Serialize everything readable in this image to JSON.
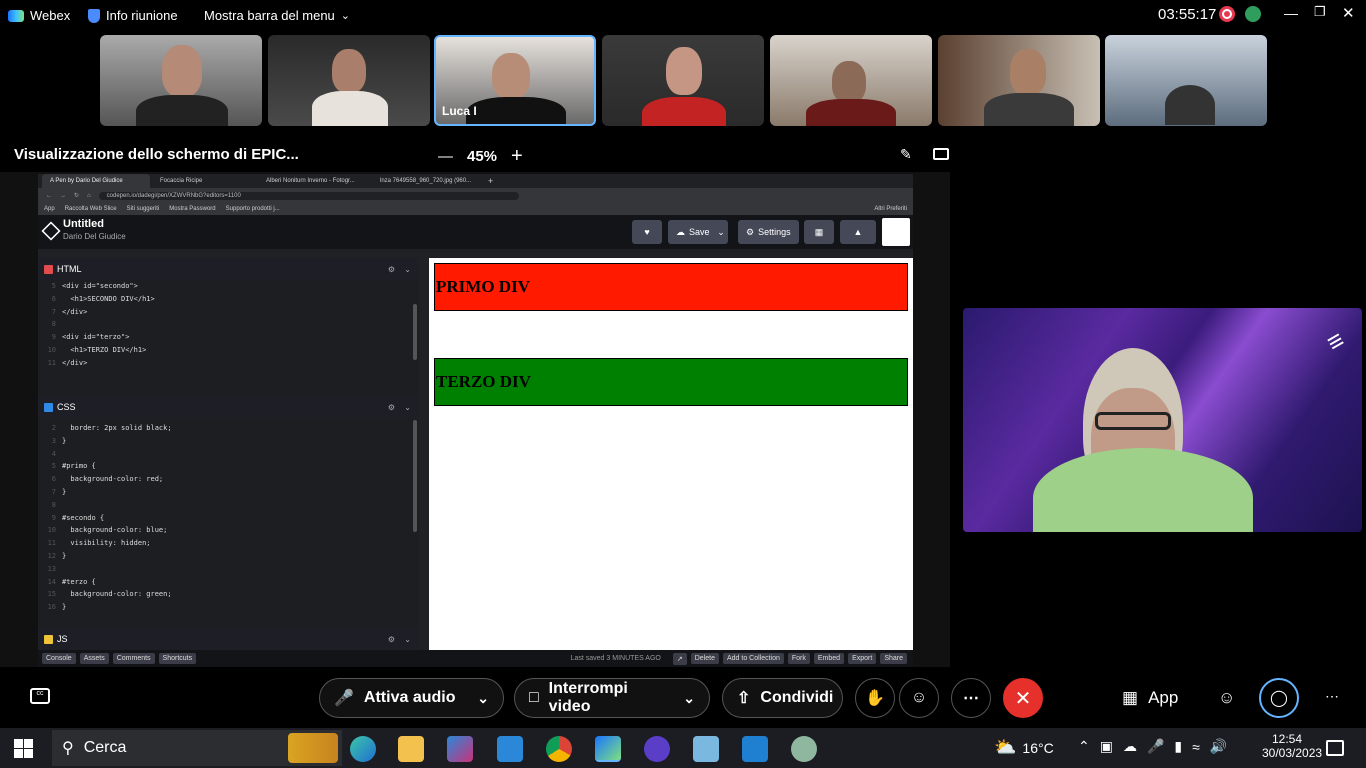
{
  "topbar": {
    "app_name": "Webex",
    "meeting_info": "Info riunione",
    "menu_toggle": "Mostra barra del menu",
    "time": "03:55:17"
  },
  "participants": [
    {
      "name": ""
    },
    {
      "name": ""
    },
    {
      "name": "Luca I"
    },
    {
      "name": ""
    },
    {
      "name": ""
    },
    {
      "name": ""
    },
    {
      "name": ""
    }
  ],
  "share": {
    "title": "Visualizzazione dello schermo di EPIC...",
    "zoom": "45%"
  },
  "browser": {
    "tabs": [
      "A Pen by Dario Del Giudice",
      "Focaccia Ricipe",
      "Alberi Noniturn Inverno - Fotogr...",
      "lnza 7649558_960_720.jpg (960..."
    ],
    "url": "codepen.io/dadegi/pen/XZWVRNbG?editors=1100",
    "bookmarks": [
      "App",
      "Raccolta Web Slice",
      "Siti suggeriti",
      "Mostra Password",
      "Supporto prodotti j...",
      "Altri Preferiti"
    ]
  },
  "codepen": {
    "title": "Untitled",
    "author": "Dario Del Giudice",
    "save": "Save",
    "settings": "Settings",
    "html_label": "HTML",
    "css_label": "CSS",
    "js_label": "JS",
    "html_lines": [
      {
        "n": "5",
        "t": "<div id=\"secondo\">"
      },
      {
        "n": "6",
        "t": "  <h1>SECONDO DIV</h1>"
      },
      {
        "n": "7",
        "t": "</div>"
      },
      {
        "n": "8",
        "t": ""
      },
      {
        "n": "9",
        "t": "<div id=\"terzo\">"
      },
      {
        "n": "10",
        "t": "  <h1>TERZO DIV</h1>"
      },
      {
        "n": "11",
        "t": "</div>"
      }
    ],
    "css_lines": [
      {
        "n": "2",
        "t": "  border: 2px solid black;"
      },
      {
        "n": "3",
        "t": "}"
      },
      {
        "n": "4",
        "t": ""
      },
      {
        "n": "5",
        "t": "#primo {"
      },
      {
        "n": "6",
        "t": "  background-color: red;"
      },
      {
        "n": "7",
        "t": "}"
      },
      {
        "n": "8",
        "t": ""
      },
      {
        "n": "9",
        "t": "#secondo {"
      },
      {
        "n": "10",
        "t": "  background-color: blue;"
      },
      {
        "n": "11",
        "t": "  visibility: hidden;"
      },
      {
        "n": "12",
        "t": "}"
      },
      {
        "n": "13",
        "t": ""
      },
      {
        "n": "14",
        "t": "#terzo {"
      },
      {
        "n": "15",
        "t": "  background-color: green;"
      },
      {
        "n": "16",
        "t": "}"
      }
    ],
    "footer_left": [
      "Console",
      "Assets",
      "Comments",
      "Shortcuts"
    ],
    "last_saved": "Last saved 3 MINUTES AGO",
    "footer_right": [
      "Delete",
      "Add to Collection",
      "Fork",
      "Embed",
      "Export",
      "Share"
    ],
    "preview": [
      {
        "text": "PRIMO DIV",
        "color": "#ff1a00"
      },
      {
        "text": "TERZO DIV",
        "color": "#008000"
      }
    ]
  },
  "controls": {
    "audio": "Attiva audio",
    "video": "Interrompi video",
    "share": "Condividi",
    "apps": "App"
  },
  "taskbar": {
    "search": "Cerca",
    "weather": "16°C",
    "time": "12:54",
    "date": "30/03/2023"
  },
  "colors": {
    "end_call": "#e5302b",
    "active_border": "#64b4ff"
  }
}
